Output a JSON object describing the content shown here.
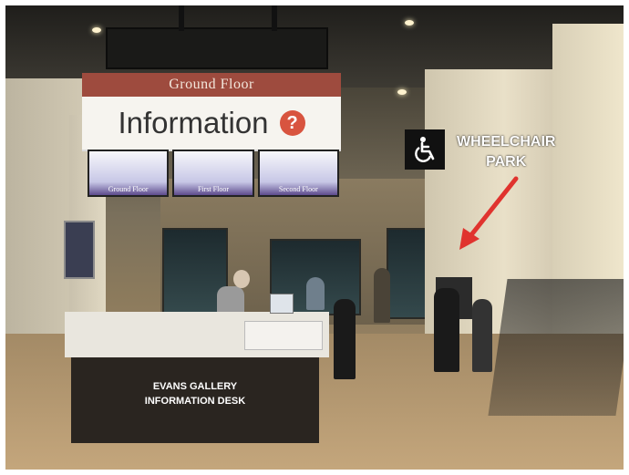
{
  "signs": {
    "ground_floor": "Ground Floor",
    "information": "Information",
    "info_icon": "?",
    "screens": [
      "Ground Floor",
      "First Floor",
      "Second Floor"
    ]
  },
  "wheelchair": {
    "icon": "wheelchair-icon",
    "label_line1": "WHEELCHAIR",
    "label_line2": "PARK"
  },
  "desk": {
    "line1": "EVANS GALLERY",
    "line2": "INFORMATION DESK"
  },
  "colors": {
    "arrow": "#e0332e",
    "ground_floor_band": "#9e4b3e",
    "info_icon_bg": "#d8543f"
  }
}
